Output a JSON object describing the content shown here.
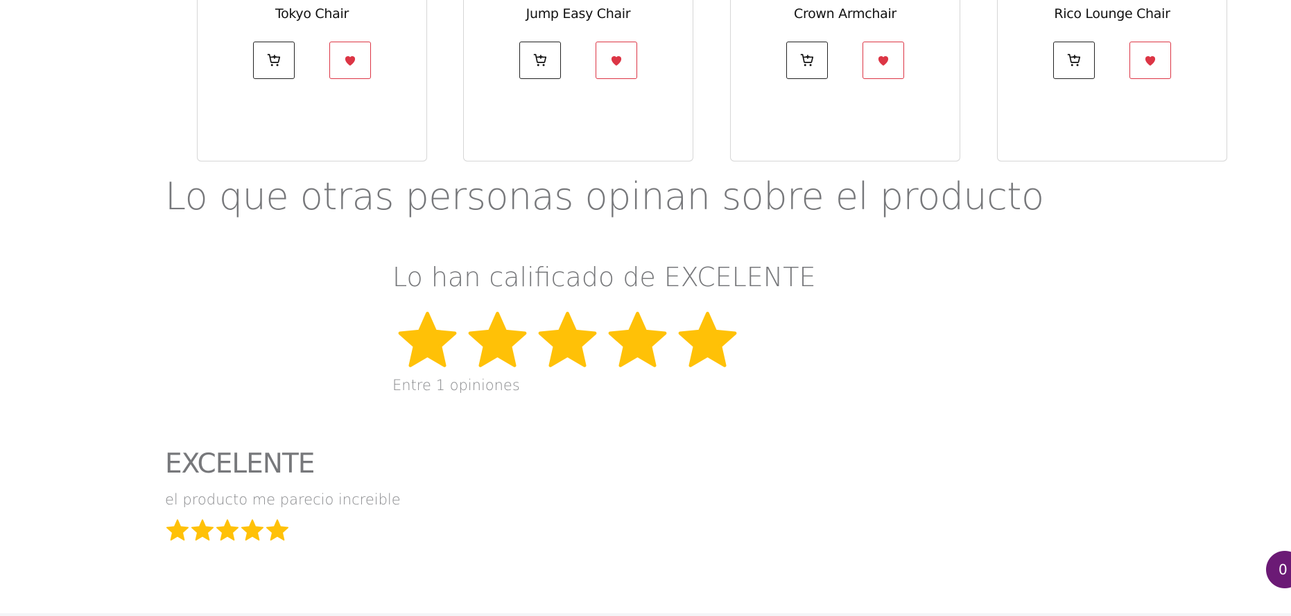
{
  "products": [
    {
      "name": "Tokyo Chair"
    },
    {
      "name": "Jump Easy Chair"
    },
    {
      "name": "Crown Armchair"
    },
    {
      "name": "Rico Lounge Chair"
    }
  ],
  "product_actions": {
    "cart_icon": "cart-plus-icon",
    "favorite_icon": "heart-icon"
  },
  "reviews_section": {
    "title": "Lo que otras personas opinan sobre el producto",
    "summary_heading": "Lo han calificado de EXCELENTE",
    "summary_rating": 5,
    "summary_max": 5,
    "opinions_text": "Entre 1 opiniones"
  },
  "reviews": [
    {
      "title": "EXCELENTE",
      "text": "el producto me parecio increible",
      "rating": 5
    }
  ],
  "cart_badge": {
    "count": "0"
  },
  "colors": {
    "star": "#FFC107",
    "favorite": "#DC3545",
    "text_muted": "#77787B",
    "badge": "#6B1A75"
  }
}
